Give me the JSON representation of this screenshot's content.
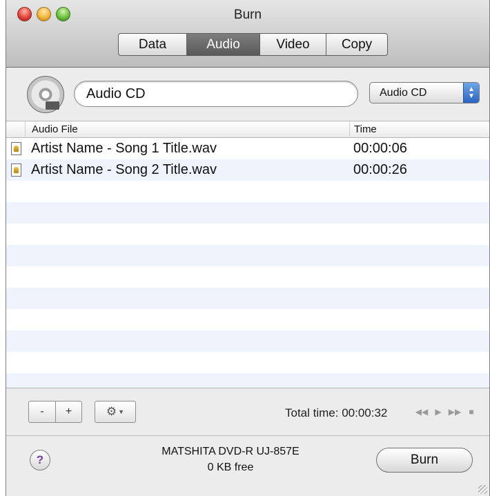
{
  "window": {
    "title": "Burn"
  },
  "tabs": [
    {
      "label": "Data",
      "active": false
    },
    {
      "label": "Audio",
      "active": true
    },
    {
      "label": "Video",
      "active": false
    },
    {
      "label": "Copy",
      "active": false
    }
  ],
  "disc": {
    "name_value": "Audio CD",
    "type_selected": "Audio CD"
  },
  "table": {
    "columns": {
      "file": "Audio File",
      "time": "Time"
    },
    "rows": [
      {
        "file": "Artist Name - Song 1 Title.wav",
        "time": "00:00:06"
      },
      {
        "file": "Artist Name - Song 2 Title.wav",
        "time": "00:00:26"
      }
    ]
  },
  "controls": {
    "remove_label": "-",
    "add_label": "+",
    "total_time": "Total time: 00:00:32"
  },
  "drive": {
    "name": "MATSHITA DVD-R UJ-857E",
    "free": "0 KB free"
  },
  "burn_label": "Burn",
  "help_label": "?",
  "icons": {
    "disc": "disc-icon",
    "gear": "gear-icon",
    "rewind": "rewind-icon",
    "play": "play-icon",
    "fast_forward": "fast-forward-icon",
    "stop": "stop-icon"
  },
  "colors": {
    "active_tab": "#666666",
    "stripe": "#eef3fc",
    "popup_arrow": "#3a74d4"
  }
}
